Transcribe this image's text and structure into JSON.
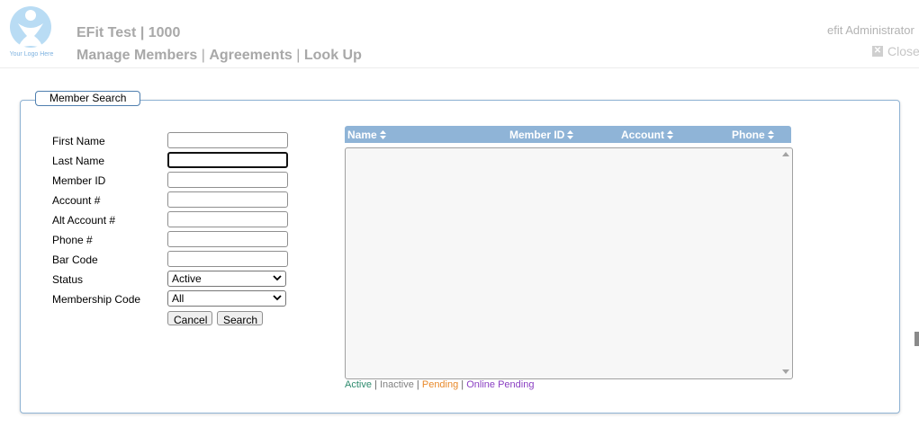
{
  "header": {
    "logo_text": "Your Logo Here",
    "title": "EFit Test | 1000",
    "nav": [
      "Manage Members",
      "Agreements",
      "Look Up"
    ],
    "user": "efit Administrator",
    "close_label": "Close"
  },
  "panel": {
    "legend": "Member Search",
    "fields": [
      {
        "label": "First Name",
        "value": ""
      },
      {
        "label": "Last Name",
        "value": ""
      },
      {
        "label": "Member ID",
        "value": ""
      },
      {
        "label": "Account #",
        "value": ""
      },
      {
        "label": "Alt Account #",
        "value": ""
      },
      {
        "label": "Phone #",
        "value": ""
      },
      {
        "label": "Bar Code",
        "value": ""
      }
    ],
    "status": {
      "label": "Status",
      "selected": "Active"
    },
    "membership_code": {
      "label": "Membership Code",
      "selected": "All"
    },
    "buttons": {
      "cancel": "Cancel",
      "search": "Search"
    }
  },
  "results": {
    "columns": [
      "Name",
      "Member ID",
      "Account",
      "Phone"
    ],
    "rows": []
  },
  "status_legend": [
    {
      "label": "Active",
      "color": "#2e8b6e"
    },
    {
      "label": "Inactive",
      "color": "#808080"
    },
    {
      "label": "Pending",
      "color": "#e8892a"
    },
    {
      "label": "Online Pending",
      "color": "#8a3fc2"
    }
  ]
}
